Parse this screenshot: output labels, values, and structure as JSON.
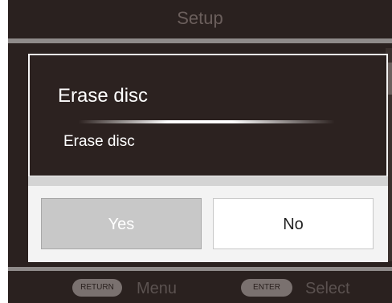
{
  "header": {
    "title": "Setup"
  },
  "dialog": {
    "title": "Erase disc",
    "message": "Erase disc",
    "yes_label": "Yes",
    "no_label": "No"
  },
  "footer": {
    "return_key": "RETURN",
    "return_action": "Menu",
    "enter_key": "ENTER",
    "enter_action": "Select"
  },
  "colors": {
    "background": "#2a211f",
    "dialog_background": "#2c2220",
    "yes_button": "#c8c8c8",
    "no_button": "#ffffff"
  }
}
